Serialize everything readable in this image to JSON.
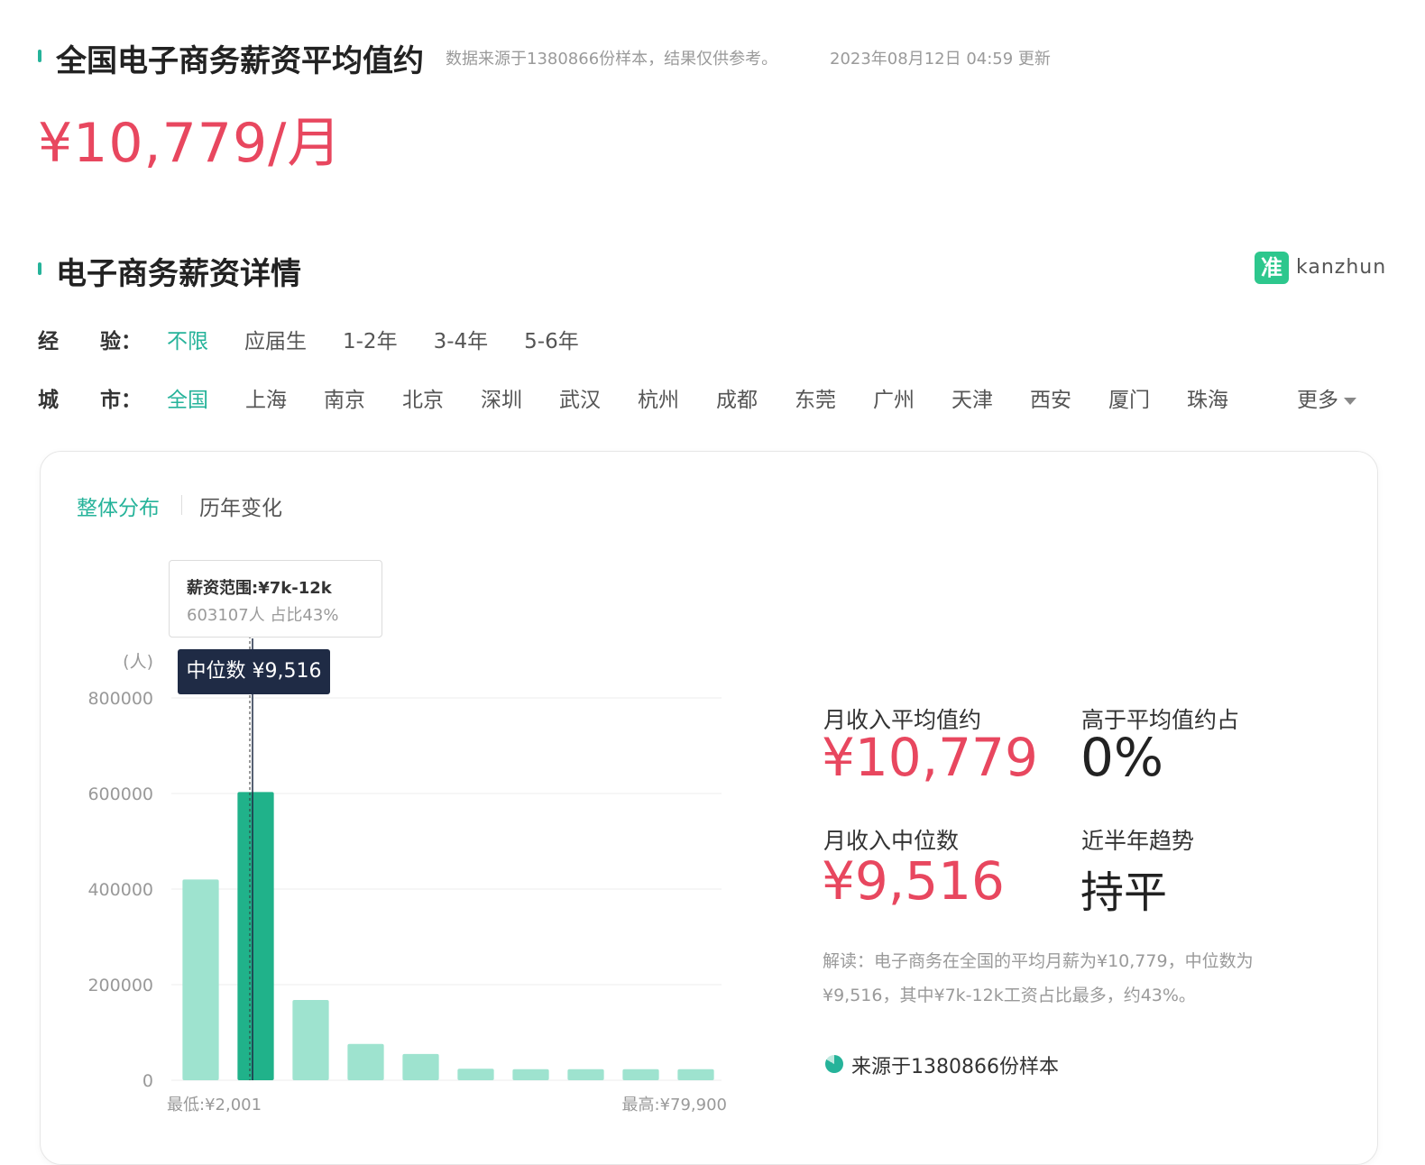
{
  "header": {
    "title": "全国电子商务薪资平均值约",
    "source_note": "数据来源于1380866份样本，结果仅供参考。",
    "updated": "2023年08月12日 04:59 更新",
    "avg_salary": "¥10,779/月"
  },
  "detail": {
    "title": "电子商务薪资详情",
    "logo_icon": "准",
    "logo_text": "kanzhun"
  },
  "filters": {
    "experience_label": "经　　验：",
    "experience_options": [
      "不限",
      "应届生",
      "1-2年",
      "3-4年",
      "5-6年"
    ],
    "city_label": "城　　市：",
    "city_options": [
      "全国",
      "上海",
      "南京",
      "北京",
      "深圳",
      "武汉",
      "杭州",
      "成都",
      "东莞",
      "广州",
      "天津",
      "西安",
      "厦门",
      "珠海"
    ],
    "more_label": "更多"
  },
  "tabs": [
    "整体分布",
    "历年变化"
  ],
  "tooltip": {
    "title": "薪资范围:¥7k-12k",
    "subtitle": "603107人  占比43%"
  },
  "median_tag": "中位数 ¥9,516",
  "chart_data": {
    "type": "bar",
    "unit_label": "(人)",
    "yticks": [
      "800000",
      "600000",
      "400000",
      "200000",
      "0"
    ],
    "ylim": [
      0,
      800000
    ],
    "values": [
      420000,
      603107,
      168000,
      76000,
      55000,
      24000,
      23000,
      23000,
      23000,
      23000
    ],
    "highlight_index": 1,
    "min_label": "最低:¥2,001",
    "max_label": "最高:¥79,900",
    "colors": {
      "bar": "#9ee3cf",
      "highlight": "#20b28a",
      "grid": "#eeeeee"
    }
  },
  "stats": {
    "avg_label": "月收入平均值约",
    "avg_value": "¥10,779",
    "above_label": "高于平均值约占",
    "above_value": "0%",
    "median_label": "月收入中位数",
    "median_value": "¥9,516",
    "trend_label": "近半年趋势",
    "trend_value": "持平",
    "interpretation": "解读：电子商务在全国的平均月薪为¥10,779，中位数为¥9,516，其中¥7k-12k工资占比最多，约43%。",
    "source": "来源于1380866份样本"
  }
}
